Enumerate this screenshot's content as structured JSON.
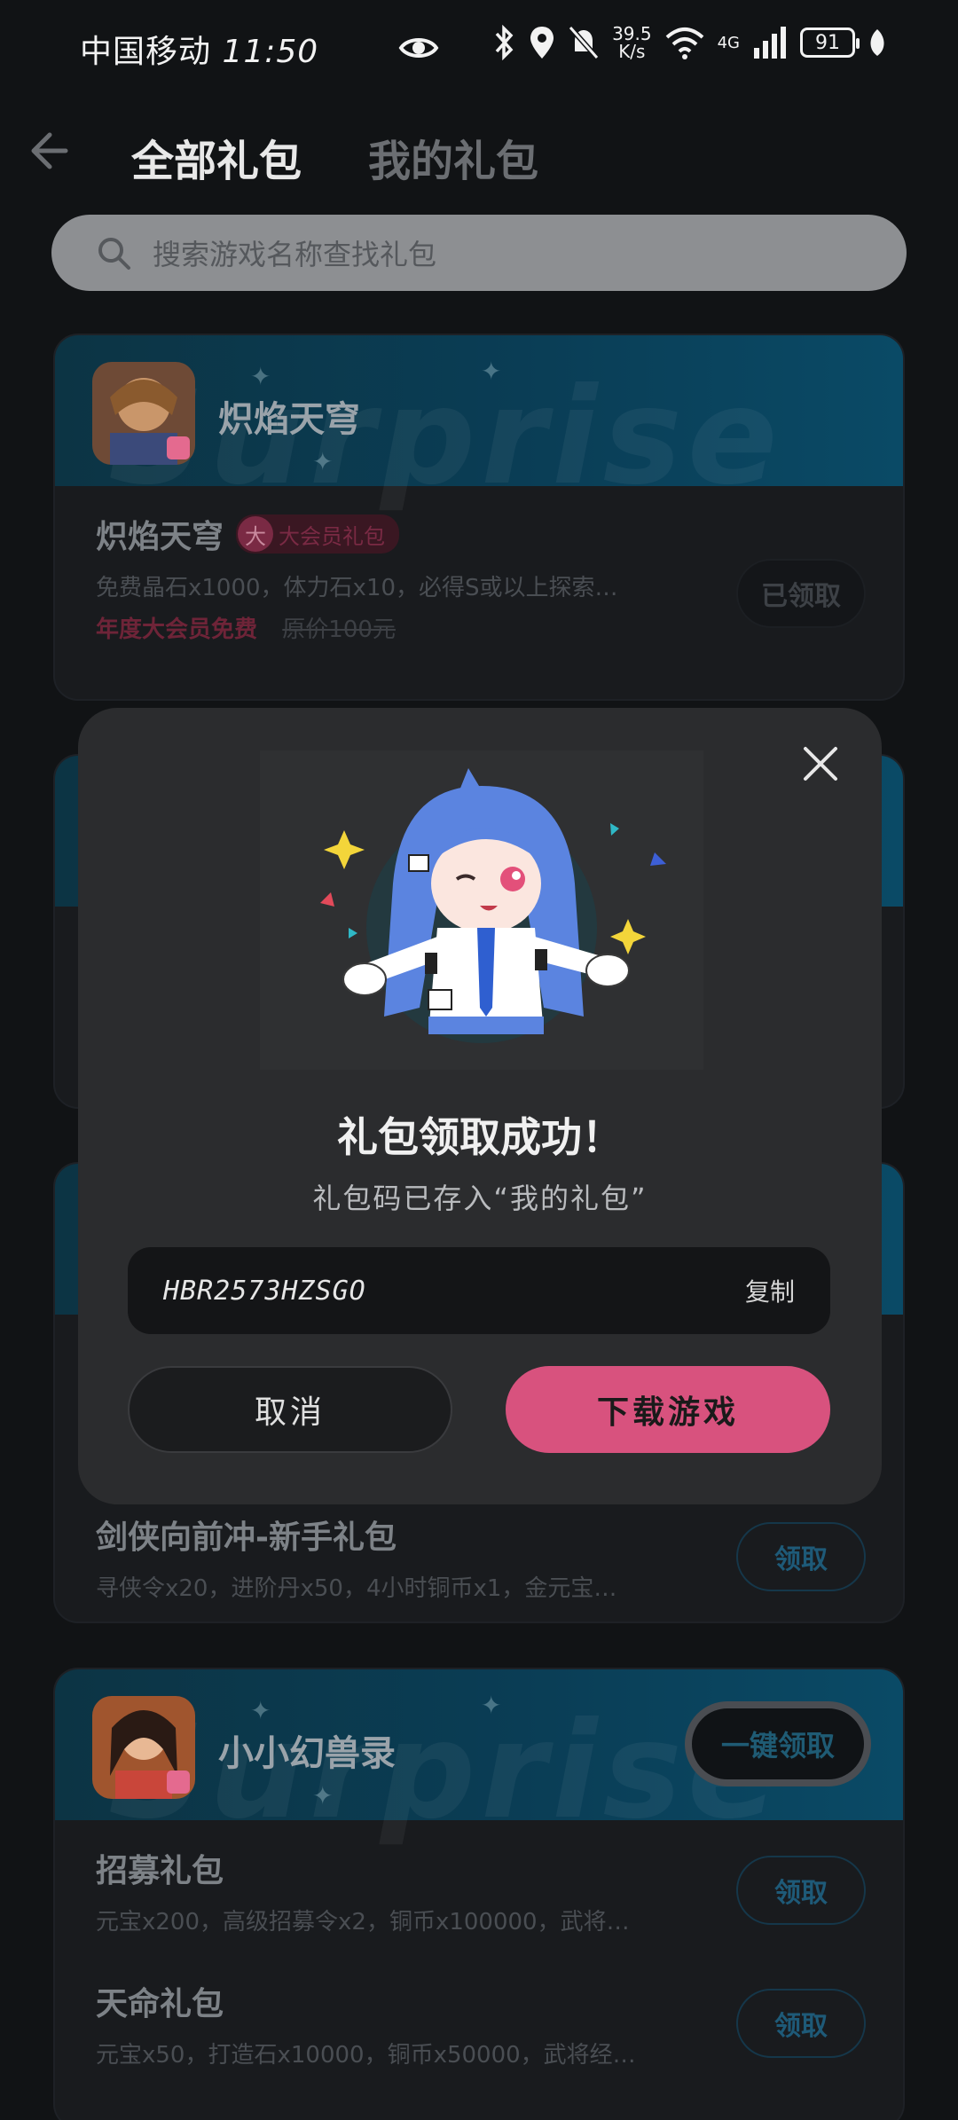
{
  "status_bar": {
    "carrier": "中国移动",
    "time": "11:50",
    "speed_value": "39.5",
    "speed_unit": "K/s",
    "net_type": "4G",
    "battery": "91"
  },
  "header": {
    "tabs": [
      {
        "label": "全部礼包",
        "active": true
      },
      {
        "label": "我的礼包",
        "active": false
      }
    ]
  },
  "search": {
    "placeholder": "搜索游戏名称查找礼包"
  },
  "cards": [
    {
      "game": "炽焰天穹",
      "watermark": "Surprise",
      "gifts": [
        {
          "name": "炽焰天穹",
          "badge_icon": "大",
          "badge_text": "大会员礼包",
          "desc": "免费晶石x1000，体力石x10，必得S或以上探索…",
          "price_free": "年度大会员免费",
          "price_orig": "原价100元",
          "button": "已领取"
        }
      ]
    },
    {
      "game": "",
      "gifts": [
        {
          "name": "剑侠向前冲-新手礼包",
          "desc": "寻侠令x20，进阶丹x50，4小时铜币x1，金元宝…",
          "button": "领取"
        }
      ]
    },
    {
      "game": "小小幻兽录",
      "watermark": "Surprise",
      "onekey": "一键领取",
      "gifts": [
        {
          "name": "招募礼包",
          "desc": "元宝x200，高级招募令x2，铜币x100000，武将…",
          "button": "领取"
        },
        {
          "name": "天命礼包",
          "desc": "元宝x50，打造石x10000，铜币x50000，武将经…",
          "button": "领取"
        }
      ]
    }
  ],
  "modal": {
    "title": "礼包领取成功！",
    "subtitle": "礼包码已存入“我的礼包”",
    "code": "HBR2573HZSGO",
    "copy": "复制",
    "cancel": "取消",
    "download": "下载游戏"
  },
  "colors": {
    "accent_pink": "#d8527e",
    "card_header_blue": "#0a3d55",
    "background": "#111315"
  }
}
